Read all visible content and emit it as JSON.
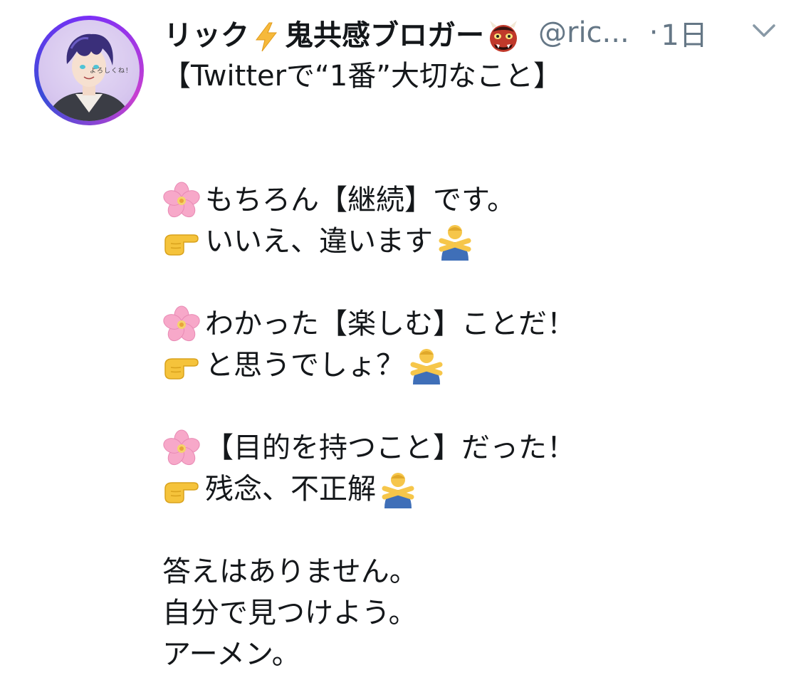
{
  "tweet": {
    "display_name": "リック",
    "display_name_suffix": "鬼共感ブロガー",
    "handle": "@ric...",
    "separator": "·",
    "timestamp": "1日",
    "icons": {
      "verified_like": "lightning-icon",
      "oni": "oni-mask-icon",
      "menu": "chevron-down-icon"
    },
    "avatar_caption": "よろしくね！",
    "lines": {
      "l1": "【Twitterで“1番”大切なこと】",
      "l2": "もちろん【継続】です。",
      "l3": "いいえ、違います",
      "l4": "わかった【楽しむ】ことだ！",
      "l5": "と思うでしょ？",
      "l6": "【目的を持つこと】だった！",
      "l7": "残念、不正解",
      "l8": "答えはありません。",
      "l9": "自分で見つけよう。",
      "l10": "アーメン。"
    },
    "emojis": {
      "flower": "cherry-blossom-icon",
      "point": "pointing-hand-icon",
      "no": "no-gesture-icon"
    }
  }
}
